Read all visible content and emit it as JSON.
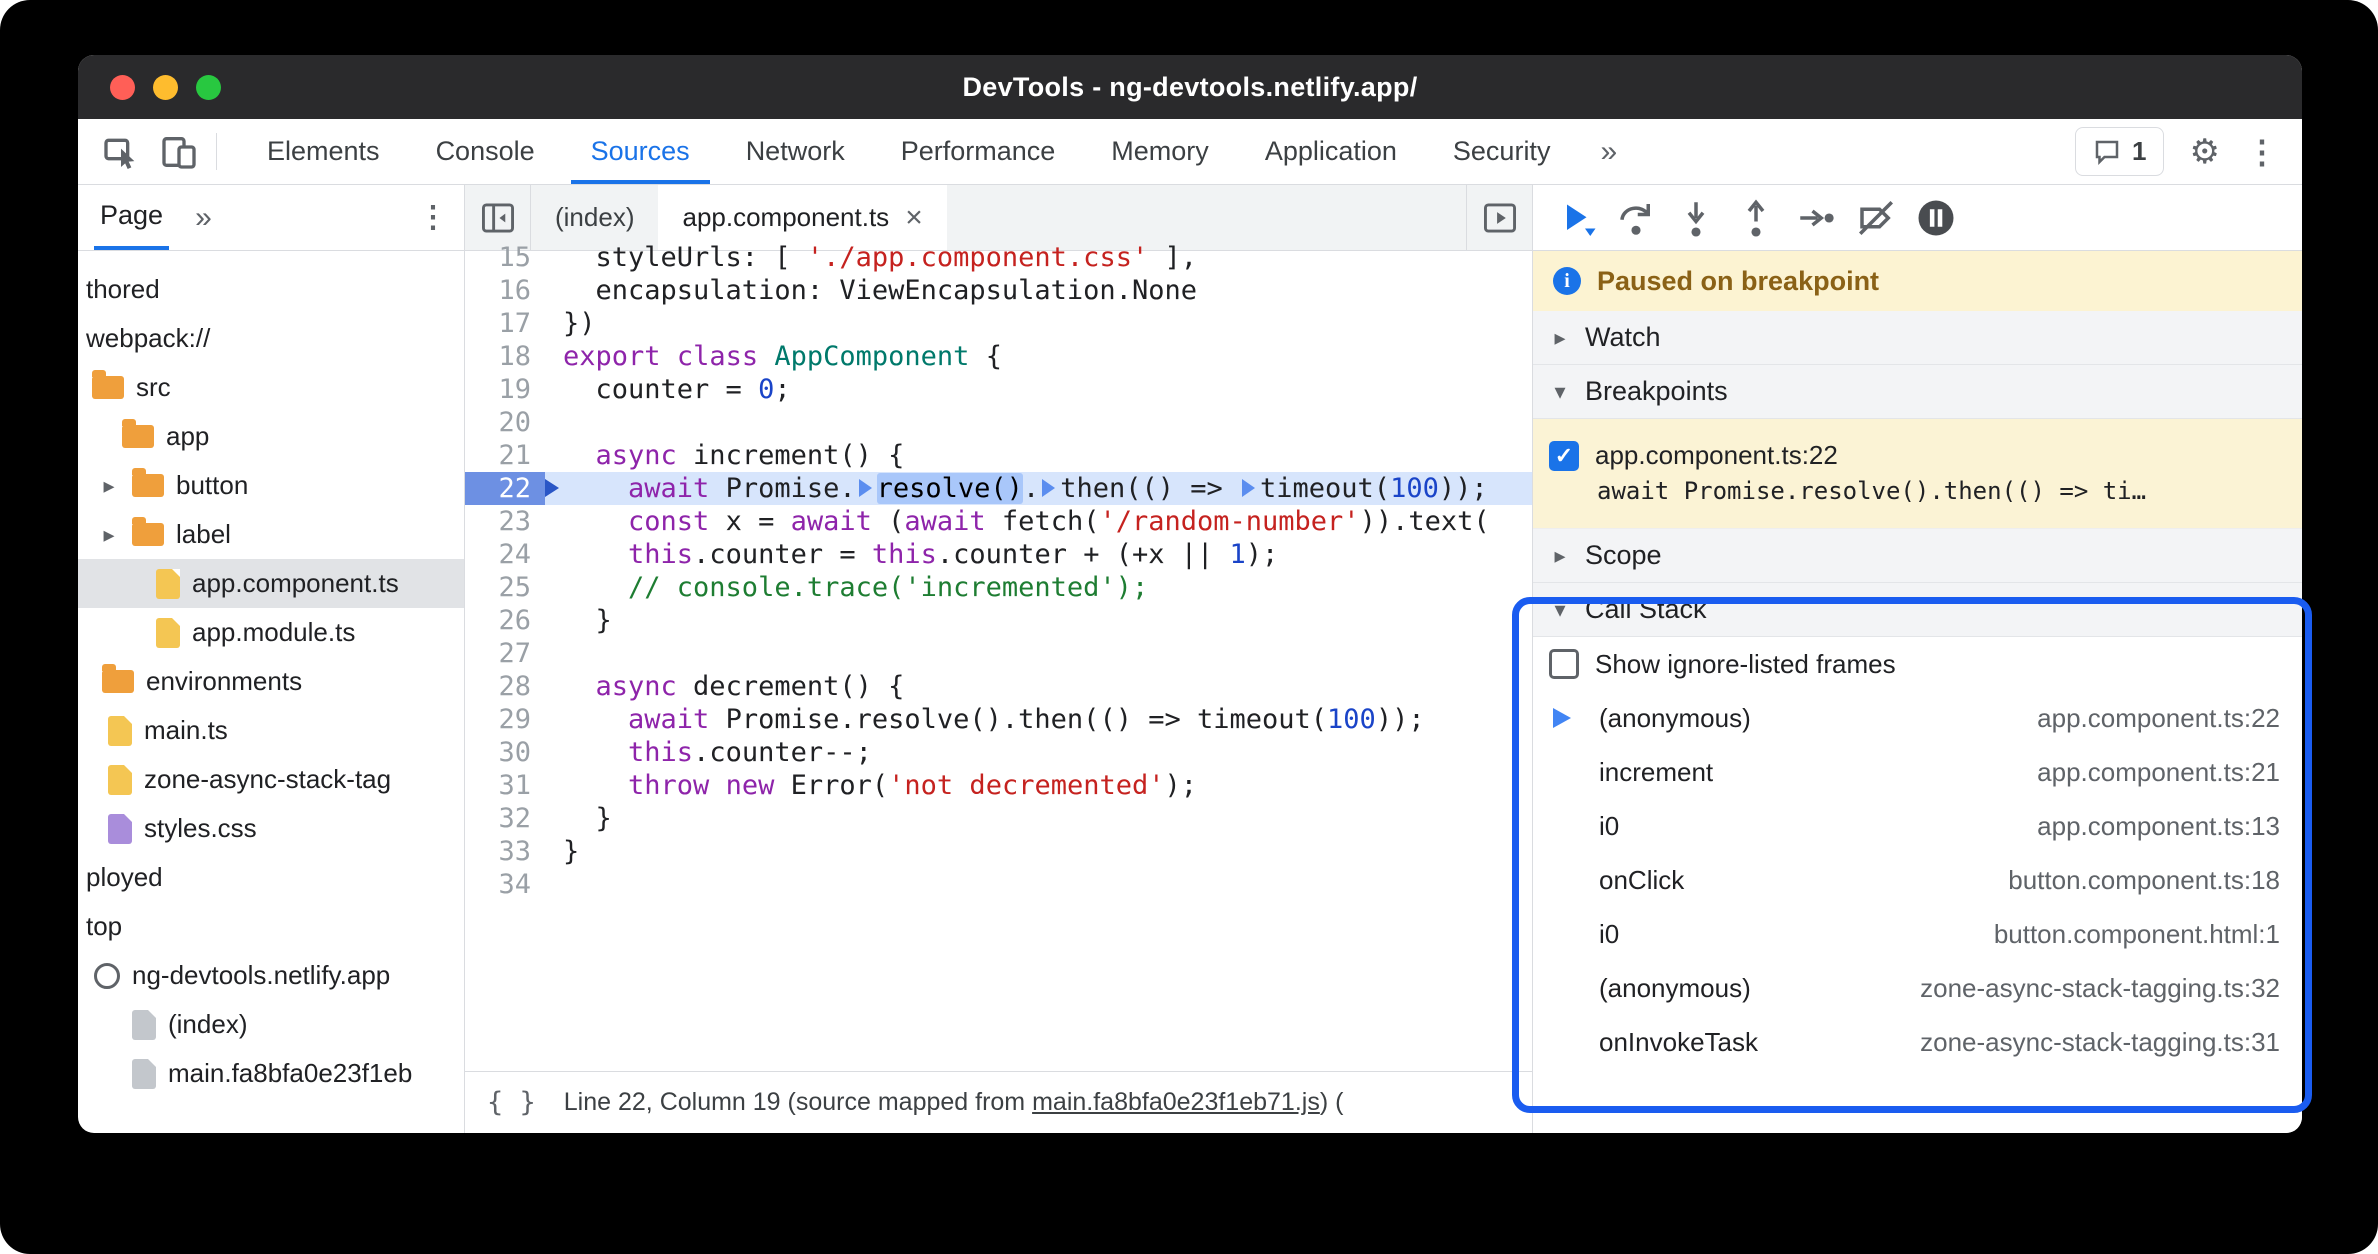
{
  "colors": {
    "accent": "#1a73e8",
    "annotation": "#1a5cf0",
    "banner-bg": "#fcf3d2",
    "banner-text": "#8a6116",
    "paused-line": "#d7e5fc",
    "gutter-active": "#6d90e3",
    "selection": "#a9c7fa",
    "keyword": "#8e24aa",
    "string": "#c5221f",
    "number": "#1a44c8",
    "comment": "#1e7d32",
    "classname": "#00796b"
  },
  "icons": {
    "collapsed": "▸",
    "expanded": "▾",
    "close": "×",
    "kebab": "⋮",
    "more": "»",
    "gear": "⚙",
    "check": "✓",
    "info": "i",
    "format": "{ }"
  },
  "window": {
    "title": "DevTools - ng-devtools.netlify.app/"
  },
  "toolbar": {
    "tabs": [
      "Elements",
      "Console",
      "Sources",
      "Network",
      "Performance",
      "Memory",
      "Application",
      "Security"
    ],
    "active_tab": "Sources",
    "issues_count": "1"
  },
  "sidebar": {
    "tab_label": "Page",
    "tree": [
      {
        "label": "thored",
        "icon": "none",
        "pad": 8
      },
      {
        "label": "webpack://",
        "icon": "none",
        "pad": 8
      },
      {
        "label": "src",
        "icon": "folder",
        "pad": 14
      },
      {
        "label": "app",
        "icon": "folder",
        "pad": 44
      },
      {
        "label": "button",
        "icon": "folder",
        "pad": 20,
        "arrow": true
      },
      {
        "label": "label",
        "icon": "folder",
        "pad": 20,
        "arrow": true
      },
      {
        "label": "app.component.ts",
        "icon": "ts",
        "pad": 78,
        "selected": true
      },
      {
        "label": "app.module.ts",
        "icon": "ts",
        "pad": 78
      },
      {
        "label": "environments",
        "icon": "folder",
        "pad": 24
      },
      {
        "label": "main.ts",
        "icon": "ts",
        "pad": 30
      },
      {
        "label": "zone-async-stack-tag",
        "icon": "ts",
        "pad": 30
      },
      {
        "label": "styles.css",
        "icon": "css",
        "pad": 30
      },
      {
        "label": "ployed",
        "icon": "none",
        "pad": 8
      },
      {
        "label": "top",
        "icon": "none",
        "pad": 8
      },
      {
        "label": "ng-devtools.netlify.app",
        "icon": "globe",
        "pad": 16
      },
      {
        "label": "(index)",
        "icon": "plain",
        "pad": 54
      },
      {
        "label": "main.fa8bfa0e23f1eb",
        "icon": "plain",
        "pad": 54
      }
    ]
  },
  "editor": {
    "tabs": [
      {
        "label": "(index)",
        "active": false
      },
      {
        "label": "app.component.ts",
        "active": true,
        "closable": true
      }
    ],
    "code": {
      "lines": [
        {
          "n": 15,
          "seg": [
            [
              "d",
              "  styleUrls: [ "
            ],
            [
              "s",
              "'./app.component.css'"
            ],
            [
              "d",
              " ],"
            ]
          ]
        },
        {
          "n": 16,
          "seg": [
            [
              "d",
              "  encapsulation: ViewEncapsulation.None"
            ]
          ]
        },
        {
          "n": 17,
          "seg": [
            [
              "d",
              "})"
            ]
          ]
        },
        {
          "n": 18,
          "seg": [
            [
              "k",
              "export"
            ],
            [
              "d",
              " "
            ],
            [
              "k",
              "class"
            ],
            [
              "d",
              " "
            ],
            [
              "cl",
              "AppComponent"
            ],
            [
              "d",
              " {"
            ]
          ]
        },
        {
          "n": 19,
          "seg": [
            [
              "d",
              "  counter = "
            ],
            [
              "n",
              "0"
            ],
            [
              "d",
              ";"
            ]
          ]
        },
        {
          "n": 20,
          "seg": []
        },
        {
          "n": 21,
          "seg": [
            [
              "d",
              "  "
            ],
            [
              "k",
              "async"
            ],
            [
              "d",
              " increment() {"
            ]
          ]
        },
        {
          "n": 22,
          "active": true,
          "seg": [
            [
              "d",
              "    "
            ],
            [
              "k",
              "await"
            ],
            [
              "d",
              " Promise."
            ],
            [
              "m",
              ""
            ],
            [
              "sel",
              "resolve()"
            ],
            [
              "d",
              "."
            ],
            [
              "m",
              ""
            ],
            [
              "d",
              "then(() => "
            ],
            [
              "m",
              ""
            ],
            [
              "d",
              "timeout("
            ],
            [
              "n",
              "100"
            ],
            [
              "d",
              "));"
            ]
          ]
        },
        {
          "n": 23,
          "seg": [
            [
              "d",
              "    "
            ],
            [
              "k",
              "const"
            ],
            [
              "d",
              " x = "
            ],
            [
              "k",
              "await"
            ],
            [
              "d",
              " ("
            ],
            [
              "k",
              "await"
            ],
            [
              "d",
              " fetch("
            ],
            [
              "s",
              "'/random-number'"
            ],
            [
              "d",
              ")).text("
            ]
          ]
        },
        {
          "n": 24,
          "seg": [
            [
              "d",
              "    "
            ],
            [
              "k",
              "this"
            ],
            [
              "d",
              ".counter = "
            ],
            [
              "k",
              "this"
            ],
            [
              "d",
              ".counter + (+x || "
            ],
            [
              "n",
              "1"
            ],
            [
              "d",
              ");"
            ]
          ]
        },
        {
          "n": 25,
          "seg": [
            [
              "cm",
              "    // console.trace('incremented');"
            ]
          ]
        },
        {
          "n": 26,
          "seg": [
            [
              "d",
              "  }"
            ]
          ]
        },
        {
          "n": 27,
          "seg": []
        },
        {
          "n": 28,
          "seg": [
            [
              "d",
              "  "
            ],
            [
              "k",
              "async"
            ],
            [
              "d",
              " decrement() {"
            ]
          ]
        },
        {
          "n": 29,
          "seg": [
            [
              "d",
              "    "
            ],
            [
              "k",
              "await"
            ],
            [
              "d",
              " Promise.resolve().then(() => timeout("
            ],
            [
              "n",
              "100"
            ],
            [
              "d",
              "));"
            ]
          ]
        },
        {
          "n": 30,
          "seg": [
            [
              "d",
              "    "
            ],
            [
              "k",
              "this"
            ],
            [
              "d",
              ".counter--;"
            ]
          ]
        },
        {
          "n": 31,
          "seg": [
            [
              "d",
              "    "
            ],
            [
              "k",
              "throw"
            ],
            [
              "d",
              " "
            ],
            [
              "k",
              "new"
            ],
            [
              "d",
              " Error("
            ],
            [
              "s",
              "'not decremented'"
            ],
            [
              "d",
              ");"
            ]
          ]
        },
        {
          "n": 32,
          "seg": [
            [
              "d",
              "  }"
            ]
          ]
        },
        {
          "n": 33,
          "seg": [
            [
              "d",
              "}"
            ]
          ]
        },
        {
          "n": 34,
          "seg": []
        }
      ]
    },
    "status": {
      "position": "Line 22, Column 19 (source mapped from ",
      "link": "main.fa8bfa0e23f1eb71.js",
      "suffix": ") ("
    }
  },
  "debugger": {
    "paused": "Paused on breakpoint",
    "sections": {
      "watch": "Watch",
      "breakpoints": "Breakpoints",
      "scope": "Scope",
      "call_stack": "Call Stack"
    },
    "breakpoint": {
      "file": "app.component.ts:22",
      "snippet": "await Promise.resolve().then(() => ti…",
      "checked": true
    },
    "show_ignore": "Show ignore-listed frames",
    "frames": [
      {
        "name": "(anonymous)",
        "loc": "app.component.ts:22",
        "active": true
      },
      {
        "name": "increment",
        "loc": "app.component.ts:21"
      },
      {
        "name": "i0",
        "loc": "app.component.ts:13"
      },
      {
        "name": "onClick",
        "loc": "button.component.ts:18"
      },
      {
        "name": "i0",
        "loc": "button.component.html:1"
      },
      {
        "name": "(anonymous)",
        "loc": "zone-async-stack-tagging.ts:32"
      },
      {
        "name": "onInvokeTask",
        "loc": "zone-async-stack-tagging.ts:31"
      }
    ]
  }
}
